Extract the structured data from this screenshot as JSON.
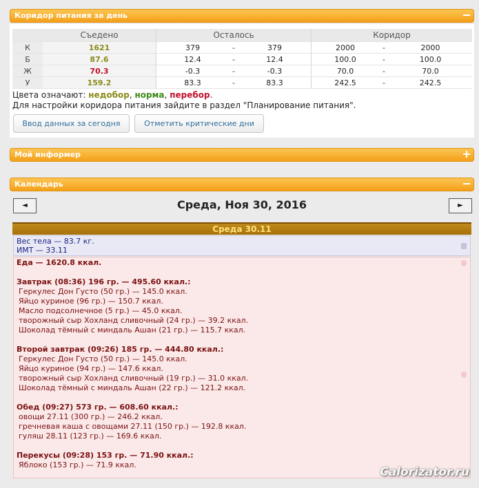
{
  "corridor": {
    "title": "Коридор питания за день",
    "headers": {
      "eaten": "Съедено",
      "left": "Осталось",
      "corridor": "Коридор"
    },
    "rows": [
      {
        "label": "К",
        "eaten": "1621",
        "eaten_status": "low",
        "left_min": "379",
        "left_max": "379",
        "cor_min": "2000",
        "cor_max": "2000"
      },
      {
        "label": "Б",
        "eaten": "87.6",
        "eaten_status": "low",
        "left_min": "12.4",
        "left_max": "12.4",
        "cor_min": "100.0",
        "cor_max": "100.0"
      },
      {
        "label": "Ж",
        "eaten": "70.3",
        "eaten_status": "high",
        "left_min": "-0.3",
        "left_max": "-0.3",
        "cor_min": "70.0",
        "cor_max": "70.0"
      },
      {
        "label": "У",
        "eaten": "159.2",
        "eaten_status": "low",
        "left_min": "83.3",
        "left_max": "83.3",
        "cor_min": "242.5",
        "cor_max": "242.5"
      }
    ],
    "dash": "-",
    "legend_prefix": "Цвета означают:",
    "legend_low": "недобор",
    "legend_ok": "норма",
    "legend_high": "перебор",
    "legend_comma": ",",
    "legend_dot": ".",
    "config_note": "Для настройки коридора питания зайдите в раздел \"Планирование питания\".",
    "btn_today": "Ввод данных за сегодня",
    "btn_critical": "Отметить критические дни"
  },
  "informer": {
    "title": "Мой информер"
  },
  "calendar": {
    "title": "Календарь",
    "prev": "◄",
    "next": "►",
    "date_title": "Среда, Ноя 30, 2016",
    "day_header": "Среда 30.11",
    "weight": "Вес тела — 83.7 кг.",
    "bmi": "ИМТ — 33.11",
    "food_total": "Еда — 1620.8 ккал.",
    "meals": [
      {
        "title": "Завтрак (08:36) 196 гр. — 495.60 ккал.:",
        "items": [
          "Геркулес Дон Густо (50 гр.) — 145.0 ккал.",
          "Яйцо куриное (96 гр.) — 150.7 ккал.",
          "Масло подсолнечное (5 гр.) — 45.0 ккал.",
          "творожный сыр Хохланд сливочный (24 гр.) — 39.2 ккал.",
          "Шоколад тёмный с миндаль Ашан (21 гр.) — 115.7 ккал."
        ]
      },
      {
        "title": "Второй завтрак (09:26) 185 гр. — 444.80 ккал.:",
        "items": [
          "Геркулес Дон Густо (50 гр.) — 145.0 ккал.",
          "Яйцо куриное (94 гр.) — 147.6 ккал.",
          "творожный сыр Хохланд сливочный (19 гр.) — 31.0 ккал.",
          "Шоколад тёмный с миндаль Ашан (22 гр.) — 121.2 ккал."
        ]
      },
      {
        "title": "Обед (09:27) 573 гр. — 608.60 ккал.:",
        "items": [
          "овощи 27.11 (300 гр.) — 246.2 ккал.",
          "гречневая каша с овощами 27.11 (150 гр.) — 192.8 ккал.",
          "гуляш 28.11 (123 гр.) — 169.6 ккал."
        ]
      },
      {
        "title": "Перекусы (09:28) 153 гр. — 71.90 ккал.:",
        "items": [
          "Яблоко (153 гр.) — 71.9 ккал."
        ]
      }
    ]
  },
  "watermark": "Calorizator.ru",
  "colors": {
    "accent": "#f3a019",
    "low": "#8a8a1a",
    "ok": "#3a8a1a",
    "high": "#c0102a"
  }
}
